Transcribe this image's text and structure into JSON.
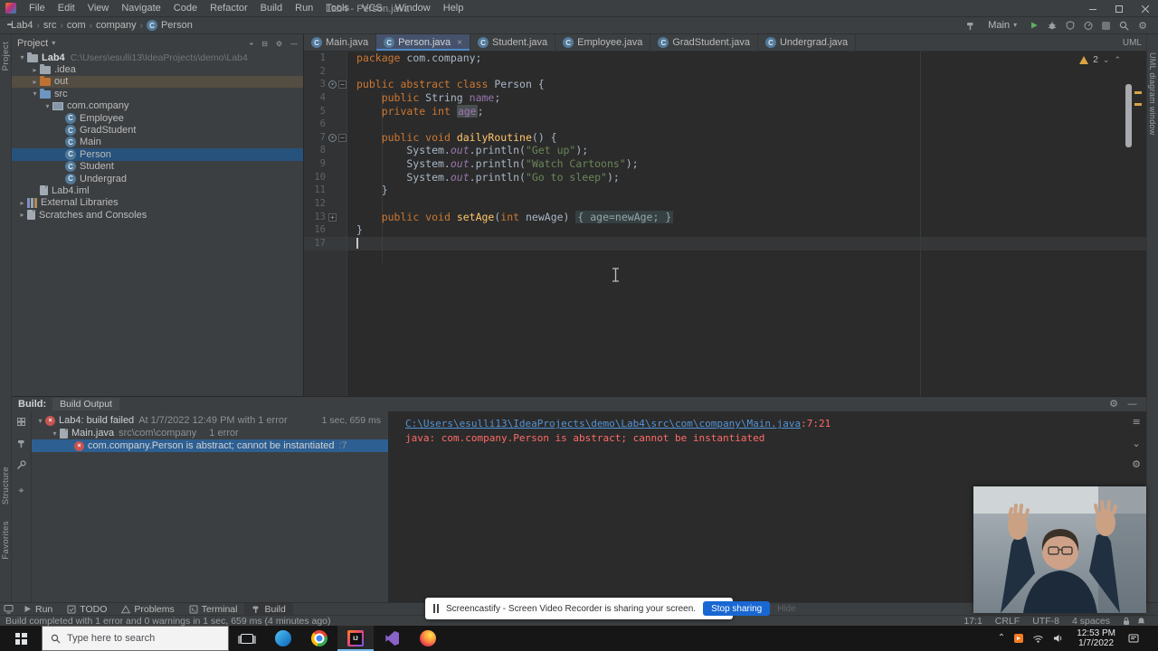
{
  "colors": {
    "keyword": "#cc7832",
    "string": "#6a8759",
    "field": "#9876aa",
    "method": "#ffc66b",
    "error_red": "#ff6b68",
    "error_icon_red": "#c75450",
    "link_blue": "#5394d6",
    "warning_yellow": "#d9a444",
    "selection_build": "#2d5f92",
    "stop_button_blue": "#1967d2"
  },
  "titlebar": {
    "title": "Lab4 - Person.java",
    "menus": [
      "File",
      "Edit",
      "View",
      "Navigate",
      "Code",
      "Refactor",
      "Build",
      "Run",
      "Tools",
      "VCS",
      "Window",
      "Help"
    ],
    "window_controls": [
      "minimize-icon",
      "maximize-icon",
      "close-icon"
    ]
  },
  "navbar": {
    "crumbs": [
      {
        "label": "Lab4",
        "icon": "folder-icon"
      },
      {
        "label": "src"
      },
      {
        "label": "com"
      },
      {
        "label": "company"
      },
      {
        "label": "Person",
        "icon": "class-icon"
      }
    ],
    "run_config_label": "Main",
    "tools": [
      "hammer-icon",
      "run-config",
      "run-icon",
      "debug-icon",
      "coverage-icon",
      "profiler-icon",
      "stop-icon",
      "search-icon",
      "settings-icon"
    ]
  },
  "stripe_labels": {
    "left_top": "Project",
    "structure": "Structure",
    "favorites": "Favorites",
    "uml_corner": "UML",
    "right_vertical": "UML diagram window"
  },
  "project_panel": {
    "header_label": "Project",
    "header_icons": [
      "locate-icon",
      "collapse-all-icon",
      "settings-icon",
      "hide-icon"
    ],
    "tree": [
      {
        "label": "Lab4",
        "path_suffix": "C:\\Users\\esulli13\\IdeaProjects\\demo\\Lab4",
        "icon": "folder",
        "indent": 0,
        "arrow": "expanded",
        "bold": true
      },
      {
        "label": ".idea",
        "icon": "folder",
        "indent": 1,
        "arrow": "collapsed"
      },
      {
        "label": "out",
        "icon": "folder-excluded",
        "indent": 1,
        "arrow": "collapsed",
        "row_highlight": true
      },
      {
        "label": "src",
        "icon": "folder-source",
        "indent": 1,
        "arrow": "expanded"
      },
      {
        "label": "com.company",
        "icon": "package",
        "indent": 2,
        "arrow": "expanded"
      },
      {
        "label": "Employee",
        "icon": "class",
        "indent": 3
      },
      {
        "label": "GradStudent",
        "icon": "class",
        "indent": 3
      },
      {
        "label": "Main",
        "icon": "class",
        "indent": 3
      },
      {
        "label": "Person",
        "icon": "class",
        "indent": 3,
        "selected": true
      },
      {
        "label": "Student",
        "icon": "class",
        "indent": 3
      },
      {
        "label": "Undergrad",
        "icon": "class",
        "indent": 3
      },
      {
        "label": "Lab4.iml",
        "icon": "file",
        "indent": 1
      },
      {
        "label": "External Libraries",
        "icon": "library",
        "indent": 0,
        "arrow": "collapsed"
      },
      {
        "label": "Scratches and Consoles",
        "icon": "file",
        "indent": 0,
        "arrow": "collapsed"
      }
    ]
  },
  "editor_tabs": [
    {
      "label": "Main.java"
    },
    {
      "label": "Person.java",
      "active": true
    },
    {
      "label": "Student.java"
    },
    {
      "label": "Employee.java"
    },
    {
      "label": "GradStudent.java"
    },
    {
      "label": "Undergrad.java"
    }
  ],
  "editor": {
    "inspection_warning_count": "2",
    "lines": [
      {
        "n": "1",
        "tokens": [
          [
            "kw",
            "package"
          ],
          [
            "pl",
            " com.company;"
          ]
        ]
      },
      {
        "n": "2",
        "tokens": []
      },
      {
        "n": "3",
        "marker": "implemented",
        "fold": "-",
        "tokens": [
          [
            "kw",
            "public abstract class"
          ],
          [
            "pl",
            " Person {"
          ]
        ]
      },
      {
        "n": "4",
        "tokens": [
          [
            "pl",
            "    "
          ],
          [
            "kw",
            "public"
          ],
          [
            "pl",
            " String "
          ],
          [
            "fld",
            "name"
          ],
          [
            "pl",
            ";"
          ]
        ]
      },
      {
        "n": "5",
        "tokens": [
          [
            "pl",
            "    "
          ],
          [
            "kw",
            "private int"
          ],
          [
            "pl",
            " "
          ],
          [
            "hl",
            "age"
          ],
          [
            "pl",
            ";"
          ]
        ]
      },
      {
        "n": "6",
        "tokens": []
      },
      {
        "n": "7",
        "marker": "implemented",
        "fold": "-",
        "tokens": [
          [
            "pl",
            "    "
          ],
          [
            "kw",
            "public void"
          ],
          [
            "pl",
            " "
          ],
          [
            "mth",
            "dailyRoutine"
          ],
          [
            "pl",
            "() {"
          ]
        ]
      },
      {
        "n": "8",
        "tokens": [
          [
            "pl",
            "        System."
          ],
          [
            "fldi",
            "out"
          ],
          [
            "pl",
            ".println("
          ],
          [
            "str",
            "\"Get up\""
          ],
          [
            "pl",
            ");"
          ]
        ]
      },
      {
        "n": "9",
        "tokens": [
          [
            "pl",
            "        System."
          ],
          [
            "fldi",
            "out"
          ],
          [
            "pl",
            ".println("
          ],
          [
            "str",
            "\"Watch Cartoons\""
          ],
          [
            "pl",
            ");"
          ]
        ]
      },
      {
        "n": "10",
        "tokens": [
          [
            "pl",
            "        System."
          ],
          [
            "fldi",
            "out"
          ],
          [
            "pl",
            ".println("
          ],
          [
            "str",
            "\"Go to sleep\""
          ],
          [
            "pl",
            ");"
          ]
        ]
      },
      {
        "n": "11",
        "tokens": [
          [
            "pl",
            "    }"
          ]
        ]
      },
      {
        "n": "12",
        "tokens": []
      },
      {
        "n": "13",
        "fold": "+",
        "tokens": [
          [
            "pl",
            "    "
          ],
          [
            "kw",
            "public void"
          ],
          [
            "pl",
            " "
          ],
          [
            "mth",
            "setAge"
          ],
          [
            "pl",
            "("
          ],
          [
            "kw",
            "int"
          ],
          [
            "pl",
            " newAge) "
          ],
          [
            "fold",
            "{ age=newAge; }"
          ]
        ]
      },
      {
        "n": "16",
        "tokens": [
          [
            "pl",
            "}"
          ]
        ]
      },
      {
        "n": "17",
        "caret": true,
        "tokens": []
      }
    ]
  },
  "build_panel": {
    "header_label": "Build:",
    "tab_label": "Build Output",
    "header_icons": [
      "settings-icon",
      "minimize-icon"
    ],
    "strip_icons": [
      "grid-icon",
      "hammer-icon",
      "wrench-icon",
      "locate-icon"
    ],
    "console_icons": [
      "soft-wrap-icon",
      "scroll-end-icon",
      "settings-icon"
    ],
    "tree": [
      {
        "indent": 0,
        "arrow": "expanded",
        "icon": "error",
        "text": "Lab4: build failed",
        "muted": "At 1/7/2022 12:49 PM with 1 error",
        "right": "1 sec, 659 ms"
      },
      {
        "indent": 1,
        "arrow": "expanded",
        "icon": "file",
        "text": "Main.java",
        "muted": "src\\com\\company",
        "muted2": "1 error"
      },
      {
        "indent": 2,
        "icon": "error",
        "text": "com.company.Person is abstract; cannot be instantiated",
        "muted": ":7",
        "selected": true
      }
    ],
    "console": [
      {
        "type": "link",
        "text": "C:\\Users\\esulli13\\IdeaProjects\\demo\\Lab4\\src\\com\\company\\Main.java",
        "suffix": ":7:21"
      },
      {
        "type": "error",
        "text": "java: com.company.Person is abstract; cannot be instantiated"
      }
    ]
  },
  "tool_buttons": [
    {
      "label": "Run",
      "icon": "play-icon"
    },
    {
      "label": "TODO",
      "icon": "todo-icon"
    },
    {
      "label": "Problems",
      "icon": "problems-icon"
    },
    {
      "label": "Terminal",
      "icon": "terminal-icon"
    },
    {
      "label": "Build",
      "icon": "build-icon",
      "active": true
    }
  ],
  "status_bar": {
    "message": "Build completed with 1 error and 0 warnings in 1 sec, 659 ms (4 minutes ago)",
    "caret_position": "17:1",
    "line_ending": "CRLF",
    "encoding": "UTF-8",
    "indent": "4 spaces",
    "icons": [
      "lock-icon",
      "bell-icon"
    ]
  },
  "taskbar": {
    "search_placeholder": "Type here to search",
    "apps": [
      "task-view-icon",
      "edge-icon",
      "chrome-icon",
      "intellij-idea-icon",
      "visual-studio-icon",
      "firefox-icon"
    ],
    "active_app": "intellij-idea-icon",
    "tray": [
      "chevron-up-icon",
      "screencastify-icon",
      "wifi-icon",
      "volume-icon"
    ],
    "time": "12:53 PM",
    "date": "1/7/2022"
  },
  "notification": {
    "text": "Screencastify - Screen Video Recorder is sharing your screen.",
    "stop_button": "Stop sharing",
    "hide_button": "Hide"
  }
}
